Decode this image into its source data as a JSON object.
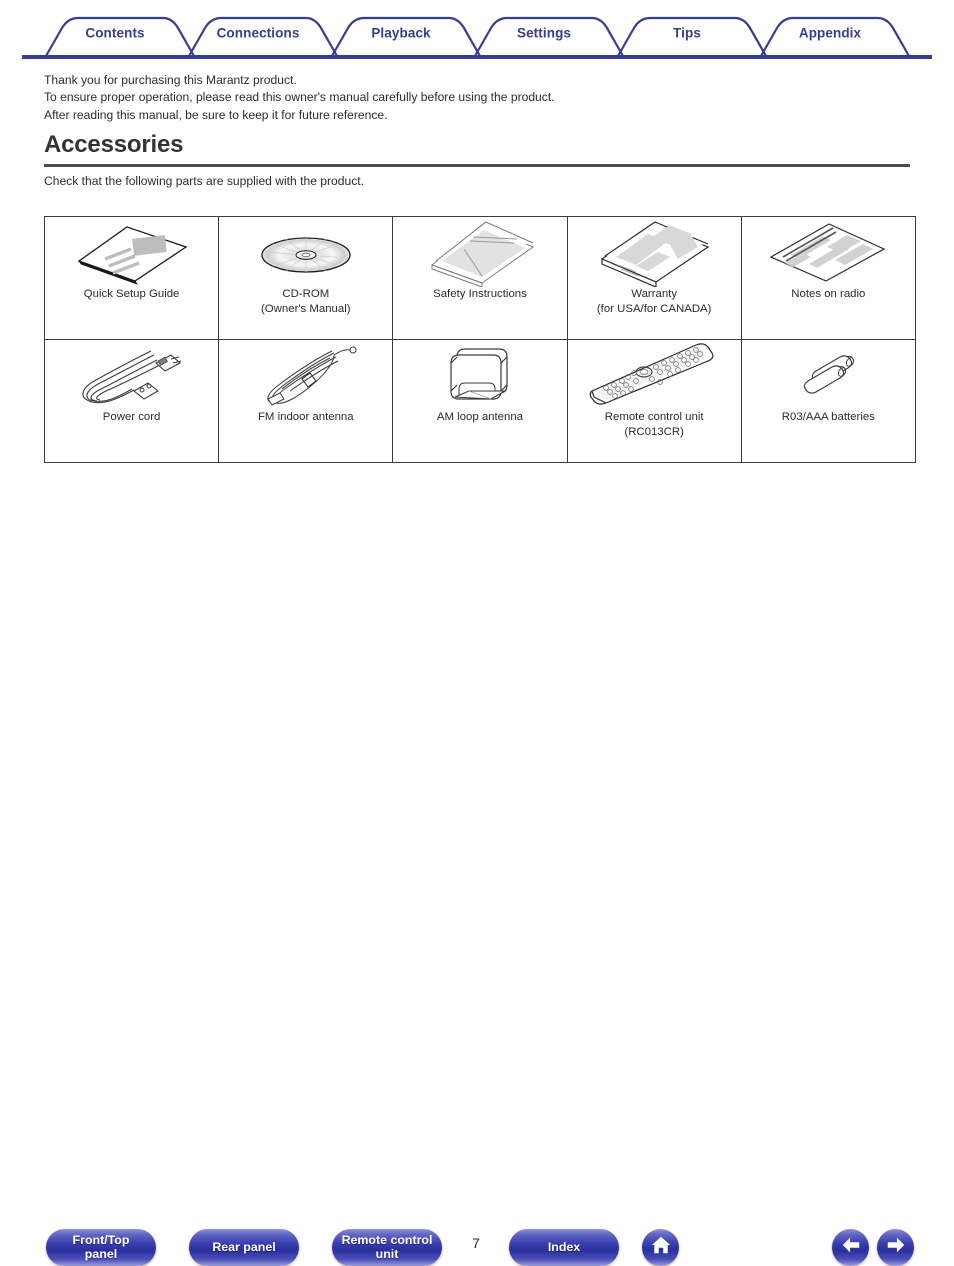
{
  "colors": {
    "tab_blue": "#363f8f",
    "button_blue": "#2b2f9e",
    "rule_gray": "#4d4d4d",
    "table_border": "#3b3b3b",
    "art_gray": "#d4d4d4"
  },
  "tabs": [
    {
      "label": "Contents",
      "name": "tab-contents"
    },
    {
      "label": "Connections",
      "name": "tab-connections"
    },
    {
      "label": "Playback",
      "name": "tab-playback"
    },
    {
      "label": "Settings",
      "name": "tab-settings"
    },
    {
      "label": "Tips",
      "name": "tab-tips"
    },
    {
      "label": "Appendix",
      "name": "tab-appendix"
    }
  ],
  "intro": {
    "line1": "Thank you for purchasing this Marantz product.",
    "line2": "To ensure proper operation, please read this owner's manual carefully before using the product.",
    "line3": "After reading this manual, be sure to keep it for future reference."
  },
  "section": {
    "heading": "Accessories",
    "subtext": "Check that the following parts are supplied with the product."
  },
  "accessories": {
    "row1": [
      {
        "caption": "Quick Setup Guide",
        "icon": "booklet-icon"
      },
      {
        "caption": "CD-ROM\n(Owner's Manual)",
        "icon": "cd-rom-icon"
      },
      {
        "caption": "Safety Instructions",
        "icon": "safety-sheet-icon"
      },
      {
        "caption": "Warranty\n(for USA/for CANADA)",
        "icon": "warranty-sheet-icon"
      },
      {
        "caption": "Notes on radio",
        "icon": "radio-notes-icon"
      }
    ],
    "row2": [
      {
        "caption": "Power cord",
        "icon": "power-cord-icon"
      },
      {
        "caption": "FM indoor antenna",
        "icon": "fm-antenna-icon"
      },
      {
        "caption": "AM loop antenna",
        "icon": "am-loop-antenna-icon"
      },
      {
        "caption": "Remote control unit\n(RC013CR)",
        "icon": "remote-control-icon"
      },
      {
        "caption": "R03/AAA batteries",
        "icon": "batteries-icon"
      }
    ]
  },
  "footer": {
    "buttons": [
      {
        "label": "Front/Top\npanel",
        "name": "front-top-panel-button"
      },
      {
        "label": "Rear panel",
        "name": "rear-panel-button"
      },
      {
        "label": "Remote control\nunit",
        "name": "remote-control-unit-button"
      },
      {
        "label": "Index",
        "name": "index-button"
      }
    ],
    "page_number": "7",
    "icons": {
      "home": "home-icon",
      "back": "arrow-left-icon",
      "forward": "arrow-right-icon"
    }
  }
}
